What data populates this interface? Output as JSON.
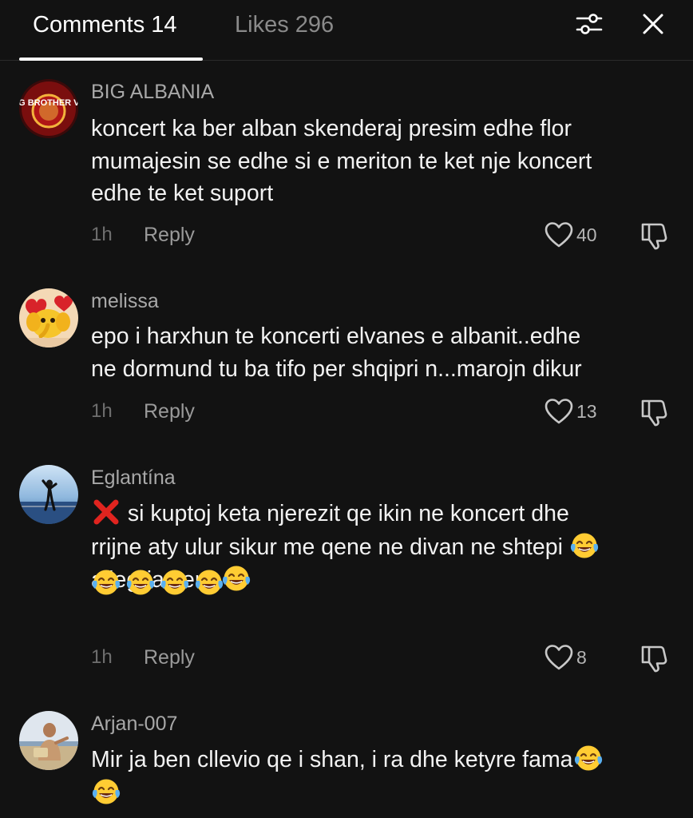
{
  "header": {
    "tabs": [
      {
        "label": "Comments 14",
        "active": true
      },
      {
        "label": "Likes 296",
        "active": false
      }
    ],
    "icons": [
      "filter-sliders-icon",
      "close-icon"
    ]
  },
  "comments": [
    {
      "username": "BIG ALBANIA",
      "avatar": "big-brother-vip-logo",
      "avatar_text": "BIG BROTHER VIP",
      "lines": [
        "koncert ka ber alban skenderaj presim edhe flor",
        "mumajesin se edhe si e meriton te ket nje koncert",
        "edhe te ket suport"
      ],
      "time": "1h",
      "reply": "Reply",
      "likes": "40"
    },
    {
      "username": "melissa",
      "avatar": "cartoon-elephant-with-hearts",
      "lines": [
        "epo i harxhun te koncerti elvanes e albanit..edhe",
        "ne dormund tu ba tifo per shqipri n...marojn dikur"
      ],
      "time": "1h",
      "reply": "Reply",
      "likes": "13"
    },
    {
      "username": "Eglantína",
      "avatar": "person-at-seaside-photo",
      "lines": [
        "si kuptoj keta njerezit qe ikin ne koncert dhe",
        "rrijne aty ulur sikur me qene ne divan ne shtepi",
        "",
        "allegria zero"
      ],
      "time": "1h",
      "reply": "Reply",
      "likes": "8"
    },
    {
      "username": "Arjan-007",
      "avatar": "man-outdoors-photo",
      "lines": [
        "Mir ja ben cllevio qe i shan, i ra dhe ketyre fama",
        ""
      ]
    }
  ],
  "emoji": {
    "cross": "cross-mark-emoji",
    "laugh": "face-with-tears-of-joy-emoji"
  },
  "colors": {
    "background": "#121212",
    "text": "#f2f2f2",
    "muted": "#a8a8a8",
    "divider": "#2a2a2a"
  }
}
